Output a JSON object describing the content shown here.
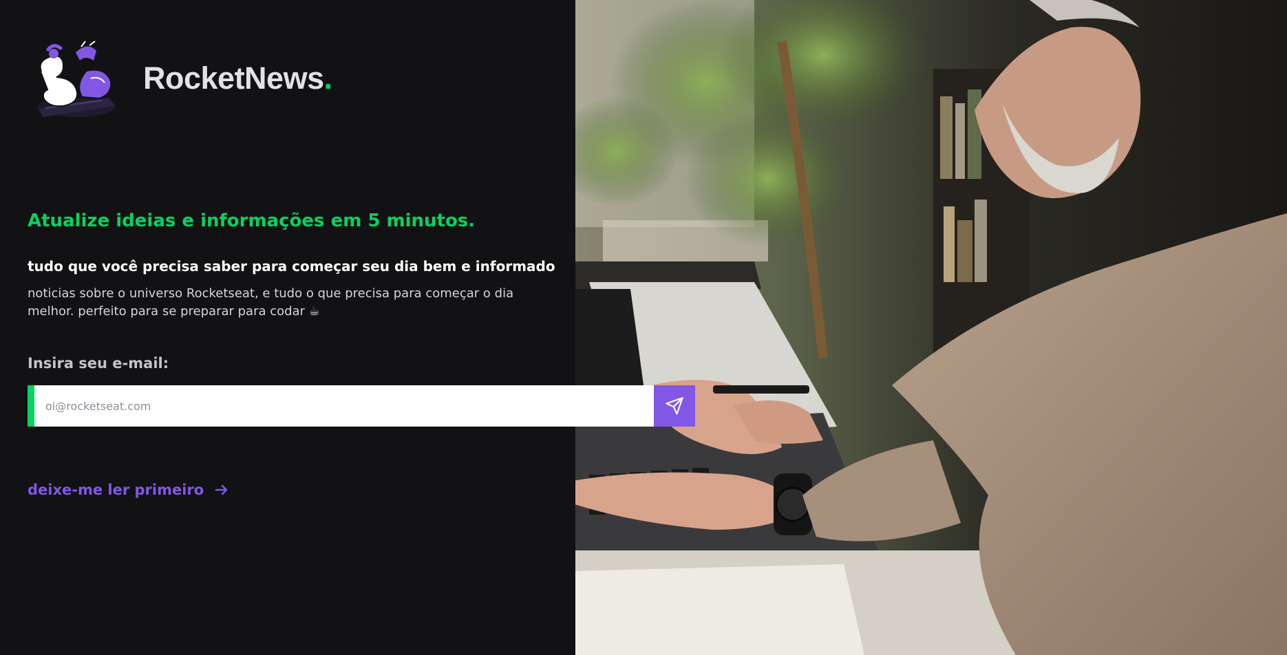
{
  "brand": {
    "name": "RocketNews",
    "dot": "."
  },
  "hero": {
    "headline": "Atualize ideias e informações em 5 minutos.",
    "subheadline": "tudo que você precisa saber para começar seu dia bem e informado",
    "description": "noticias sobre o universo Rocketseat, e tudo o que precisa para começar o dia melhor. perfeito para se preparar para codar ☕"
  },
  "form": {
    "email_label": "Insira seu e-mail:",
    "email_placeholder": "oi@rocketseat.com",
    "email_value": "",
    "send_icon": "send-icon"
  },
  "cta": {
    "read_first": "deixe-me ler primeiro",
    "icon": "arrow-right-icon"
  },
  "colors": {
    "background": "#121214",
    "green": "#04d361",
    "purple": "#8257e5",
    "text": "#e1e1e6"
  }
}
